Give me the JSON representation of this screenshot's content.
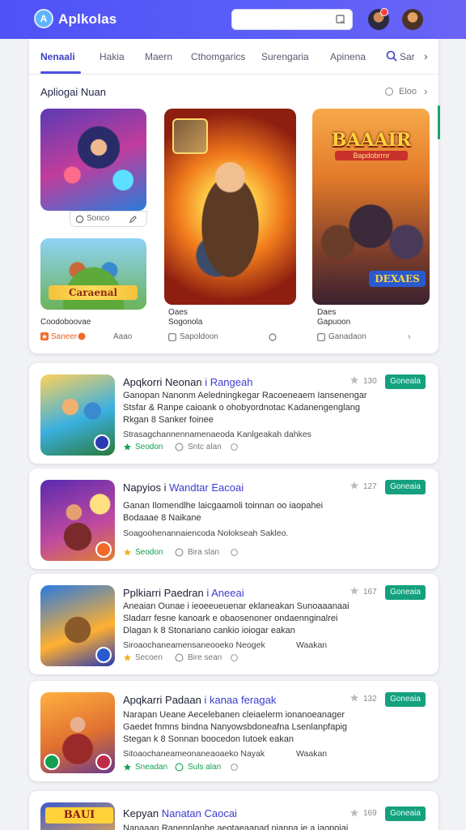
{
  "header": {
    "logo_glyph": "A",
    "app_title": "Aplkolas",
    "search_placeholder": "",
    "accent_color": "#5457f6"
  },
  "tabs": [
    {
      "label": "Nenaali",
      "active": true
    },
    {
      "label": "Hakia",
      "active": false
    },
    {
      "label": "Maern",
      "active": false
    },
    {
      "label": "Cthomgarics",
      "active": false
    },
    {
      "label": "Surengaria",
      "active": false
    },
    {
      "label": "Apinena",
      "active": false
    },
    {
      "label": "Sar",
      "active": false
    }
  ],
  "featured": {
    "title": "Apliogai Nuan",
    "more_label": "Eloo",
    "art_a_caption": "Sonco",
    "art_b_banner": "Caraenal",
    "art_d_title": "BAAAIR",
    "art_d_sub": "Bapdobrrnr",
    "art_d_badge": "DEXAES",
    "captions": {
      "b_title": "Coodoboovae",
      "b_meta": "Saneer",
      "b_meta_right": "Aaao",
      "c_title": "Oaes",
      "c_subtitle": "Sogonola",
      "c_meta": "Sapoldoon",
      "d_title": "Daes",
      "d_subtitle": "Gapuoon",
      "d_meta": "Ganadaon"
    }
  },
  "apps": [
    {
      "title": "Apqkorri Neonan",
      "title_accent": "i Rangeah",
      "rating": "130",
      "install_label": "Goneala",
      "desc_lines": [
        "Ganopan Nanonm Aeledningkegar Racoeneaem Iansenengar",
        "Stsfar & Ranpe caioank o ohobyordnotac Kadanengenglang",
        "Rkgan 8 Sanker foinee"
      ],
      "meta_line": "Strasagchannennamenaeoda Kanlgeakah dahkes",
      "tag_primary": "Seodon",
      "tag_secondary": "Sntc alan"
    },
    {
      "title": "Napyios i",
      "title_accent": "Wandtar Eacoai",
      "rating": "127",
      "install_label": "Goneaia",
      "desc_lines": [
        "Ganan Ilomendlhe laicgaamoli toinnan oo iaopahei",
        "Bodaaae 8 Naikane"
      ],
      "meta_line": "Soagoohenannaiencoda Nolokseah Sakleo.",
      "tag_primary": "Seodon",
      "tag_secondary": "Bira slan"
    },
    {
      "title": "Pplkiarri Paedran",
      "title_accent": "i Aneeai",
      "rating": "167",
      "install_label": "Goneaia",
      "desc_lines": [
        "Aneaian Ounae i ieoeeueuenar eklaneakan Sunoaaanaai",
        "Sladarr fesne kanoark e obaosenoner ondaennginalrei",
        "Dlagan k 8 Stonariano cankio ioiogar eakan"
      ],
      "meta_line": "Siroaochaneamensaneooeko Neogek",
      "meta_suffix": "Waakan",
      "tag_primary": "Secoen",
      "tag_secondary": "Bire sean"
    },
    {
      "title": "Apqkarri Padaan",
      "title_accent": "i kanaa feragak",
      "rating": "132",
      "install_label": "Goneaia",
      "desc_lines": [
        "Narapan Ueane Aecelebanen cleiaelerm ionanoeanager",
        "Gaedet fnmns bindna Nanyowsbdoneafna Lsenlanpfapig",
        "Stegan k 8 Sonnan boocedon Iutoek eakan"
      ],
      "meta_line": "Sitoaochaneameonaneaoaeko Nayak",
      "meta_suffix": "Waakan",
      "tag_primary": "Sneadan",
      "tag_secondary": "Suls alan"
    },
    {
      "title": "Kepyan",
      "title_accent": "Nanatan Caocai",
      "rating": "169",
      "install_label": "Goneaia",
      "thumb_title": "BAUI",
      "desc_lines": [
        "Nanaaan Ranennlanhe aeotaeaanad nianna ie a iaopoiai"
      ],
      "meta_line": "",
      "tag_primary": "",
      "tag_secondary": ""
    }
  ]
}
